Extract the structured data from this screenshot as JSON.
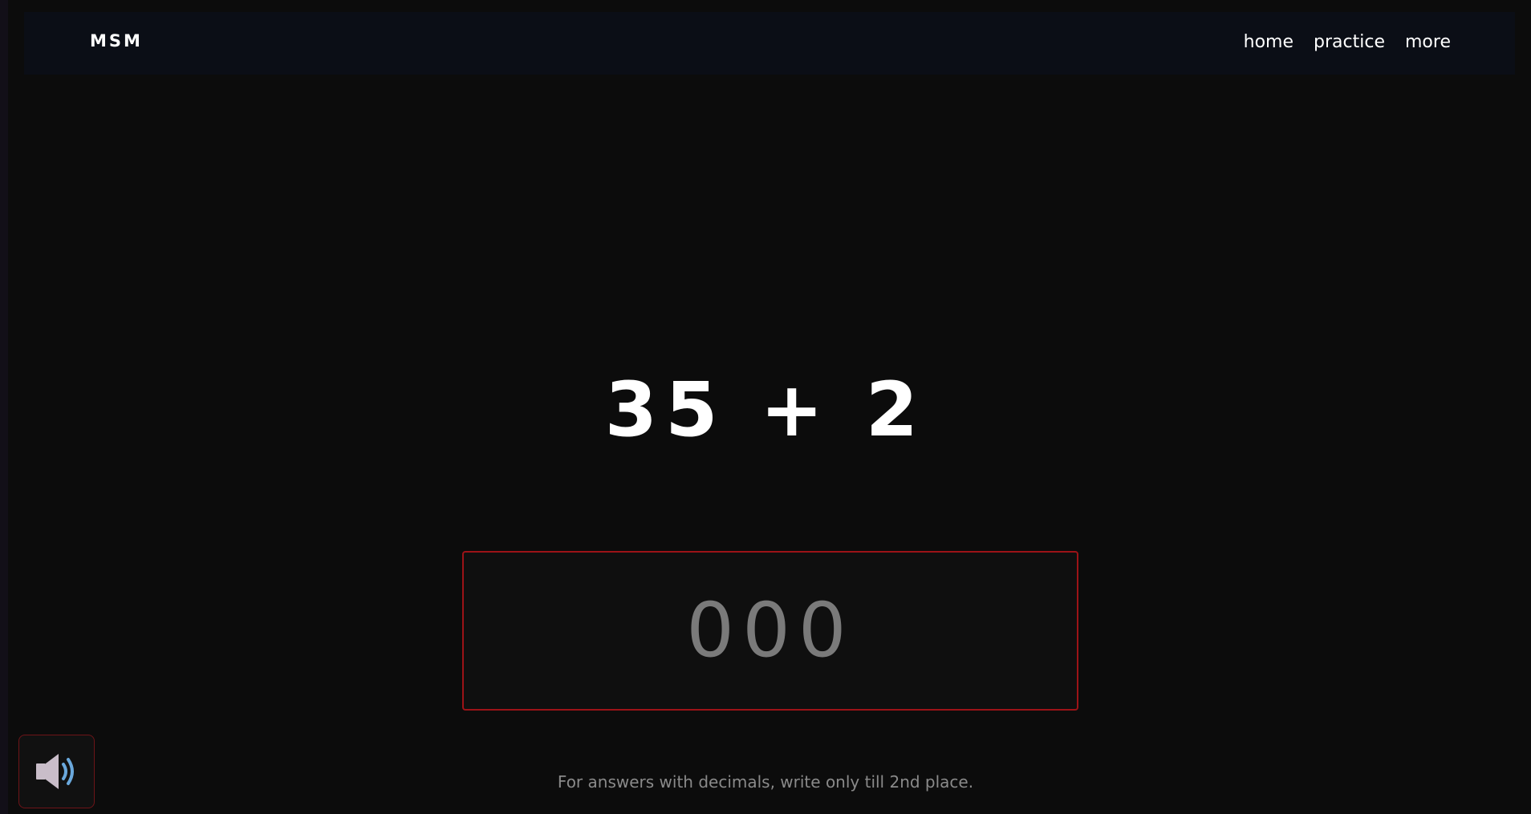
{
  "nav": {
    "brand": "MSM",
    "links": [
      {
        "label": "home"
      },
      {
        "label": "practice"
      },
      {
        "label": "more"
      }
    ]
  },
  "problem": {
    "expression": "35 + 2"
  },
  "answer": {
    "value": "",
    "placeholder": "000"
  },
  "hint": "For answers with decimals, write only till 2nd place.",
  "sound": {
    "icon": "speaker-volume-icon"
  },
  "colors": {
    "background": "#0c0c0c",
    "navbar": "#0b0e16",
    "answer_border": "#9c1317",
    "speaker_body": "#c9bdc9",
    "sound_waves": "#6aa8dc"
  }
}
